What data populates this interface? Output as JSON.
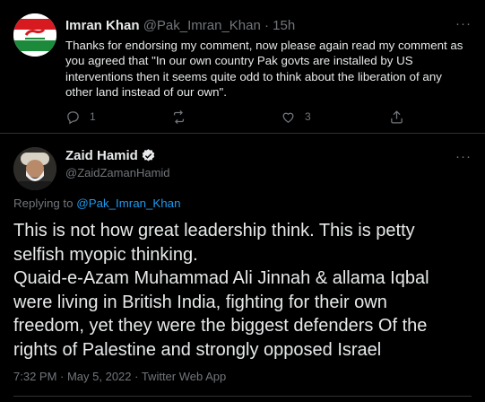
{
  "tweet1": {
    "name": "Imran Khan",
    "handle": "@Pak_Imran_Khan",
    "separator": "·",
    "time": "15h",
    "lines": [
      "Thanks for endorsing my comment, now please again read my comment as",
      "you agreed that \"In our own country Pak govts are installed by US",
      "interventions then it seems quite odd to think about the liberation of any",
      "other land instead of our own\"."
    ],
    "actions": {
      "reply_count": "1",
      "retweet_count": "",
      "like_count": "3"
    },
    "avatar_icon": "party-flag-avatar"
  },
  "tweet2": {
    "name": "Zaid Hamid",
    "handle": "@ZaidZamanHamid",
    "replying_prefix": "Replying to ",
    "replying_handle": "@Pak_Imran_Khan",
    "lines": [
      "This is not how great leadership think. This is petty",
      "selfish myopic thinking.",
      "Quaid-e-Azam Muhammad Ali Jinnah & allama Iqbal",
      "were living in British India, fighting for their own",
      "freedom, yet they were the biggest defenders Of the",
      "rights of Palestine and strongly opposed Israel"
    ],
    "meta": "7:32 PM · May 5, 2022 · Twitter Web App",
    "verified_icon": "verified-badge-icon"
  },
  "more_label": "···",
  "colors": {
    "background": "#000000",
    "text": "#e7e9ea",
    "muted": "#71767b",
    "link": "#1d9bf0",
    "border": "#2f3336"
  }
}
